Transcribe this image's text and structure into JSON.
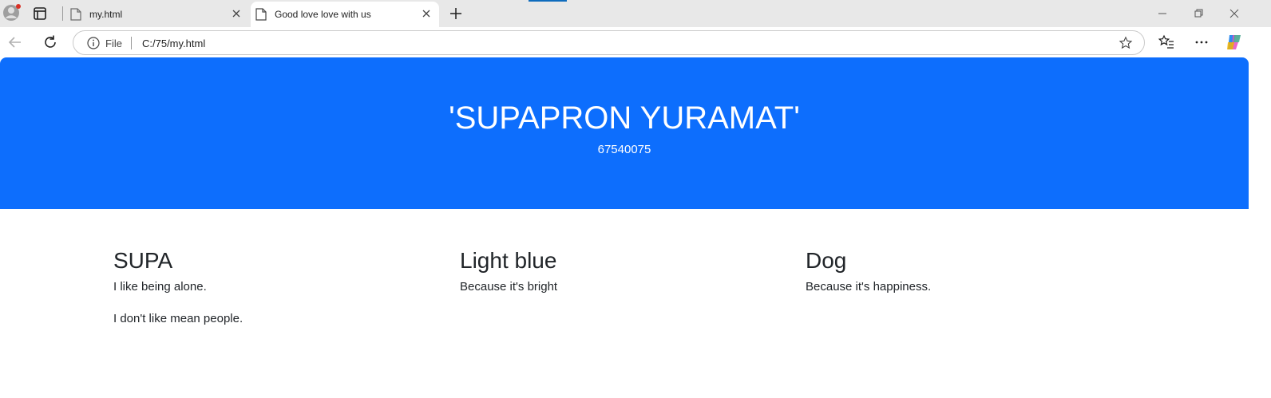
{
  "browser": {
    "tabs": [
      {
        "title": "my.html",
        "active": false
      },
      {
        "title": "Good love love with us",
        "active": true
      }
    ],
    "address": {
      "scheme_label": "File",
      "url": "C:/75/my.html"
    },
    "accent": "#0f6cbd"
  },
  "page": {
    "hero": {
      "title": "'SUPAPRON YURAMAT'",
      "subtitle": "67540075",
      "background": "#0d6efd"
    },
    "columns": [
      {
        "heading": "SUPA",
        "lines": [
          "I like being alone.",
          "I don't like mean people."
        ]
      },
      {
        "heading": "Light blue",
        "lines": [
          "Because it's bright"
        ]
      },
      {
        "heading": "Dog",
        "lines": [
          "Because it's happiness."
        ]
      }
    ]
  }
}
